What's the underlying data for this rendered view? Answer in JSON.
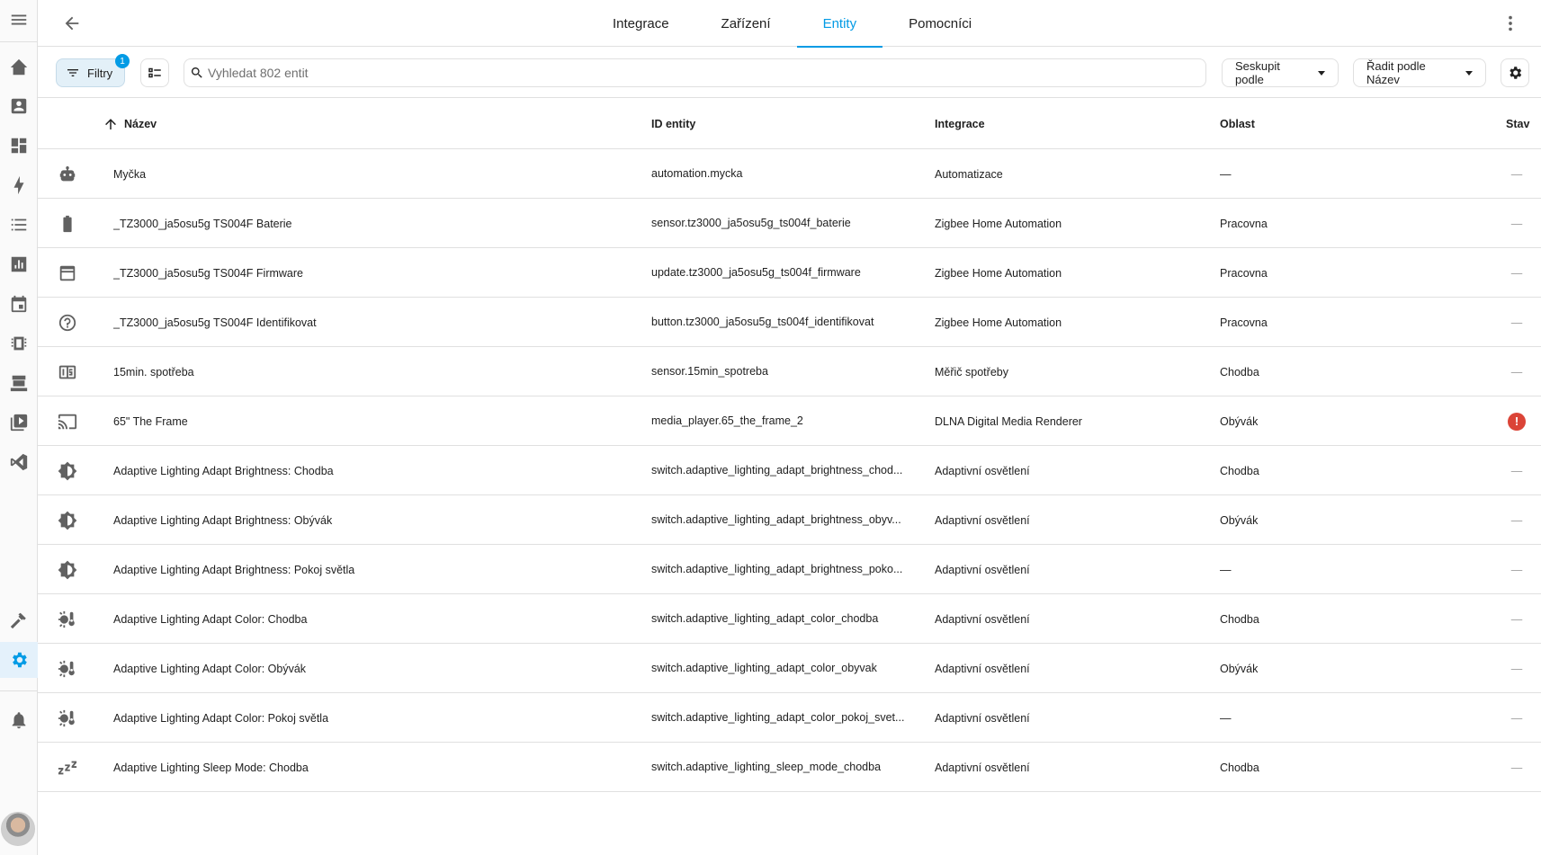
{
  "sidebar": {
    "items": [
      {
        "icon": "menu-icon"
      },
      {
        "icon": "home-assistant-icon"
      },
      {
        "icon": "account-box-icon"
      },
      {
        "icon": "dashboard-icon"
      },
      {
        "icon": "lightning-bolt-icon"
      },
      {
        "icon": "list-icon"
      },
      {
        "icon": "chart-bar-icon"
      },
      {
        "icon": "calendar-icon"
      },
      {
        "icon": "chip-icon"
      },
      {
        "icon": "hacs-store-icon",
        "label": "HACS"
      },
      {
        "icon": "media-icon"
      },
      {
        "icon": "vscode-icon"
      },
      {
        "icon": "hammer-icon"
      },
      {
        "icon": "settings-icon"
      },
      {
        "icon": "bell-icon"
      }
    ]
  },
  "header": {
    "tabs": [
      {
        "label": "Integrace"
      },
      {
        "label": "Zařízení"
      },
      {
        "label": "Entity"
      },
      {
        "label": "Pomocníci"
      }
    ],
    "active_tab": "Entity"
  },
  "toolbar": {
    "filter_label": "Filtry",
    "filter_count": "1",
    "search_placeholder": "Vyhledat 802 entit",
    "group_label": "Seskupit podle",
    "sort_label": "Řadit podle Název"
  },
  "table": {
    "columns": {
      "name": "Název",
      "entity_id": "ID entity",
      "integration": "Integrace",
      "area": "Oblast",
      "state": "Stav"
    },
    "rows": [
      {
        "icon": "robot-icon",
        "name": "Myčka",
        "entity_id": "automation.mycka",
        "integration": "Automatizace",
        "area": "—",
        "state": "—"
      },
      {
        "icon": "battery-icon",
        "name": "_TZ3000_ja5osu5g TS004F Baterie",
        "entity_id": "sensor.tz3000_ja5osu5g_ts004f_baterie",
        "integration": "Zigbee Home Automation",
        "area": "Pracovna",
        "state": "—"
      },
      {
        "icon": "package-icon",
        "name": "_TZ3000_ja5osu5g TS004F Firmware",
        "entity_id": "update.tz3000_ja5osu5g_ts004f_firmware",
        "integration": "Zigbee Home Automation",
        "area": "Pracovna",
        "state": "—"
      },
      {
        "icon": "help-circle-icon",
        "name": "_TZ3000_ja5osu5g TS004F Identifikovat",
        "entity_id": "button.tz3000_ja5osu5g_ts004f_identifikovat",
        "integration": "Zigbee Home Automation",
        "area": "Pracovna",
        "state": "—"
      },
      {
        "icon": "counter-icon",
        "name": "15min. spotřeba",
        "entity_id": "sensor.15min_spotreba",
        "integration": "Měřič spotřeby",
        "area": "Chodba",
        "state": "—"
      },
      {
        "icon": "cast-icon",
        "name": "65\" The Frame",
        "entity_id": "media_player.65_the_frame_2",
        "integration": "DLNA Digital Media Renderer",
        "area": "Obývák",
        "state": "!"
      },
      {
        "icon": "brightness-icon",
        "name": "Adaptive Lighting Adapt Brightness: Chodba",
        "entity_id": "switch.adaptive_lighting_adapt_brightness_chod...",
        "integration": "Adaptivní osvětlení",
        "area": "Chodba",
        "state": "—"
      },
      {
        "icon": "brightness-icon",
        "name": "Adaptive Lighting Adapt Brightness: Obývák",
        "entity_id": "switch.adaptive_lighting_adapt_brightness_obyv...",
        "integration": "Adaptivní osvětlení",
        "area": "Obývák",
        "state": "—"
      },
      {
        "icon": "brightness-icon",
        "name": "Adaptive Lighting Adapt Brightness: Pokoj světla",
        "entity_id": "switch.adaptive_lighting_adapt_brightness_poko...",
        "integration": "Adaptivní osvětlení",
        "area": "—",
        "state": "—"
      },
      {
        "icon": "sun-thermometer-icon",
        "name": "Adaptive Lighting Adapt Color: Chodba",
        "entity_id": "switch.adaptive_lighting_adapt_color_chodba",
        "integration": "Adaptivní osvětlení",
        "area": "Chodba",
        "state": "—"
      },
      {
        "icon": "sun-thermometer-icon",
        "name": "Adaptive Lighting Adapt Color: Obývák",
        "entity_id": "switch.adaptive_lighting_adapt_color_obyvak",
        "integration": "Adaptivní osvětlení",
        "area": "Obývák",
        "state": "—"
      },
      {
        "icon": "sun-thermometer-icon",
        "name": "Adaptive Lighting Adapt Color: Pokoj světla",
        "entity_id": "switch.adaptive_lighting_adapt_color_pokoj_svet...",
        "integration": "Adaptivní osvětlení",
        "area": "—",
        "state": "—"
      },
      {
        "icon": "sleep-icon",
        "name": "Adaptive Lighting Sleep Mode: Chodba",
        "entity_id": "switch.adaptive_lighting_sleep_mode_chodba",
        "integration": "Adaptivní osvětlení",
        "area": "Chodba",
        "state": "—"
      }
    ]
  },
  "colors": {
    "accent": "#039be5",
    "error": "#db4437",
    "icon": "#616161",
    "divider": "#e0e0e0"
  }
}
